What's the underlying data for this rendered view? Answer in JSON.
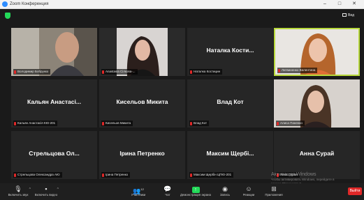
{
  "window": {
    "title": "Zoom Конференция",
    "minimize": "–",
    "maximize": "□",
    "close": "✕"
  },
  "header": {
    "view_label": "Вид",
    "security_icon": "shield-icon"
  },
  "participants": [
    {
      "label": "Володимир Бобрукко",
      "video": true,
      "muted": true
    },
    {
      "label": "Anastasia Сілкова-...",
      "video": true,
      "muted": true
    },
    {
      "display_name": "Наталка Кости...",
      "label": "Наталка Костицин",
      "video": false,
      "muted": true
    },
    {
      "label": "Литвиненко Валентина",
      "video": true,
      "muted": true,
      "active_speaker": true
    },
    {
      "display_name": "Кальян Анастасі...",
      "label": "Кальян Анастасія КЮ-201",
      "video": false,
      "muted": true
    },
    {
      "display_name": "Кисельов Микита",
      "label": "Кисельов Микита",
      "video": false,
      "muted": true
    },
    {
      "display_name": "Влад Кот",
      "label": "Влад Кот",
      "video": false,
      "muted": true
    },
    {
      "label": "Алиса Паненко",
      "video": true,
      "muted": true
    },
    {
      "display_name": "Стрельцова Ол...",
      "label": "Стрельцова Олександра АЮ",
      "video": false,
      "muted": true
    },
    {
      "display_name": "Ірина Петренко",
      "label": "Ірина Петренко",
      "video": false,
      "muted": true
    },
    {
      "display_name": "Максим Щербі...",
      "label": "Максим Щербін ЦПЮ-201",
      "video": false,
      "muted": true
    },
    {
      "display_name": "Анна Сурай",
      "label": "Анна Сурай",
      "video": false,
      "muted": true
    }
  ],
  "toolbar": {
    "mute": "Включить звук",
    "video": "Включить видео",
    "participants": "Участники",
    "participants_count": "12",
    "chat": "Чат",
    "share": "Демонстрация экрана",
    "record": "Запись",
    "reactions": "Реакции",
    "apps": "Приложения",
    "end": "Выйти"
  },
  "watermark": {
    "title": "Активация Windows",
    "line1": "Чтобы активировать Windows, перейдите в",
    "line2": "раздел \"Параметры\"."
  },
  "colors": {
    "background": "#1a1a1a",
    "tile": "#262626",
    "active_border": "#b8d93b",
    "muted_mic": "#e02828",
    "share_green": "#23d959",
    "end_red": "#e02828"
  }
}
